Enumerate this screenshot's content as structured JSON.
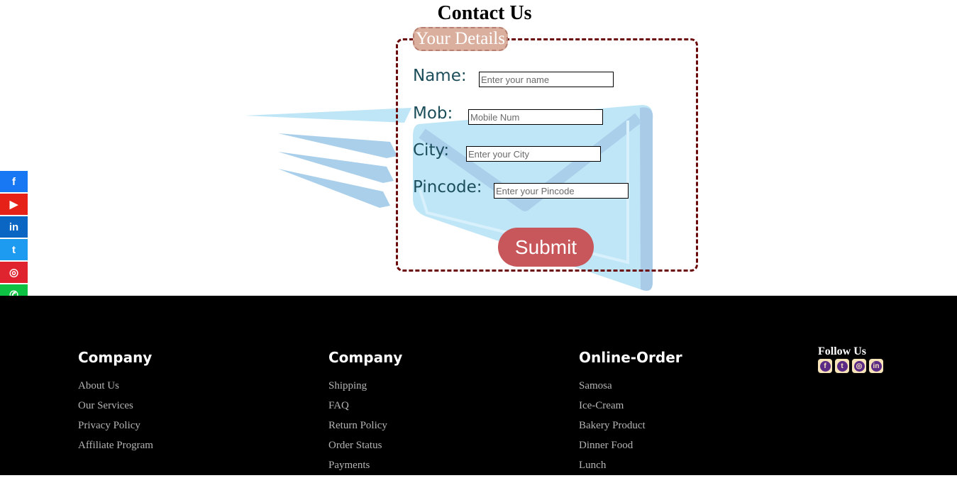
{
  "page": {
    "title": "Contact Us"
  },
  "form": {
    "legend": "Your Details",
    "fields": [
      {
        "label": "Name:",
        "placeholder": "Enter your name"
      },
      {
        "label": "Mob:",
        "placeholder": "Mobile Num"
      },
      {
        "label": "City:",
        "placeholder": "Enter your City"
      },
      {
        "label": "Pincode:",
        "placeholder": "Enter your Pincode"
      }
    ],
    "submit_label": "Submit"
  },
  "social_sidebar": [
    {
      "icon": "facebook-icon",
      "glyph": "f",
      "color": "#1877f2"
    },
    {
      "icon": "youtube-icon",
      "glyph": "▶",
      "color": "#e62117"
    },
    {
      "icon": "linkedin-icon",
      "glyph": "in",
      "color": "#0a66c2"
    },
    {
      "icon": "twitter-icon",
      "glyph": "t",
      "color": "#1d9bf0"
    },
    {
      "icon": "instagram-icon",
      "glyph": "◎",
      "color": "#e0242f"
    },
    {
      "icon": "whatsapp-icon",
      "glyph": "✆",
      "color": "#0dc143"
    }
  ],
  "footer": {
    "columns": [
      {
        "title": "Company",
        "links": [
          "About Us",
          "Our Services",
          "Privacy Policy",
          "Affiliate Program"
        ]
      },
      {
        "title": "Company",
        "links": [
          "Shipping",
          "FAQ",
          "Return Policy",
          "Order Status",
          "Payments"
        ]
      },
      {
        "title": "Online-Order",
        "links": [
          "Samosa",
          "Ice-Cream",
          "Bakery Product",
          "Dinner Food",
          "Lunch"
        ]
      }
    ],
    "follow": {
      "title": "Follow Us",
      "icons": [
        {
          "icon": "facebook-icon",
          "glyph": "f"
        },
        {
          "icon": "twitter-icon",
          "glyph": "t"
        },
        {
          "icon": "instagram-icon",
          "glyph": "◎"
        },
        {
          "icon": "linkedin-icon",
          "glyph": "in"
        }
      ]
    }
  },
  "colors": {
    "form_border": "#6b0a0a",
    "legend_bg": "#dbaf9e",
    "label": "#1b4e5a",
    "submit_bg": "#c7575a",
    "footer_bg": "#000000",
    "footer_link": "#b4b4b4"
  }
}
